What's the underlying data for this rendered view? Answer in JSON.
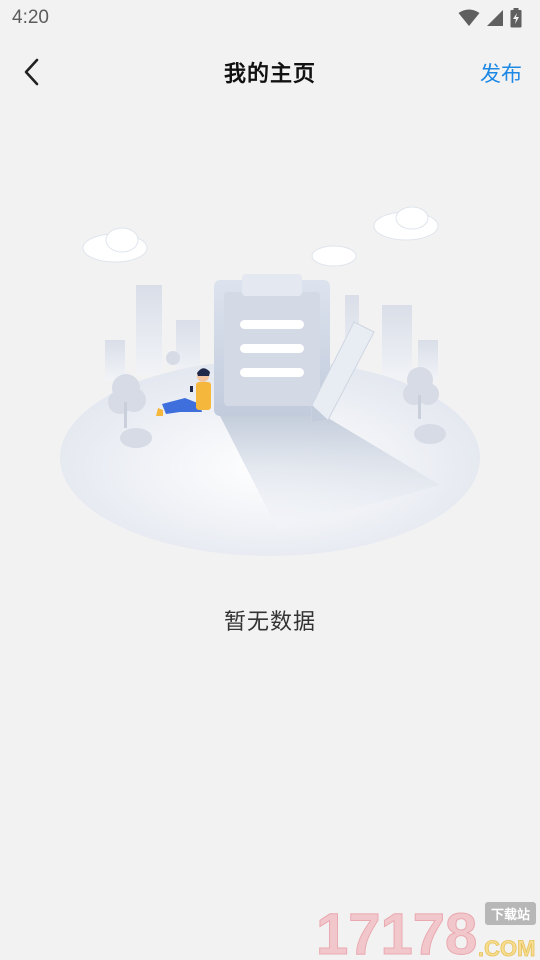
{
  "status_bar": {
    "time": "4:20"
  },
  "nav": {
    "title": "我的主页",
    "action_label": "发布"
  },
  "empty_state": {
    "message": "暂无数据"
  },
  "watermark": {
    "text": "17178",
    "domain": ".COM",
    "badge": "下载站"
  },
  "colors": {
    "accent": "#1e88e5",
    "background": "#f2f2f2"
  },
  "icons": {
    "back": "chevron-left-icon",
    "wifi": "wifi-icon",
    "signal": "signal-icon",
    "battery": "battery-charging-icon"
  }
}
